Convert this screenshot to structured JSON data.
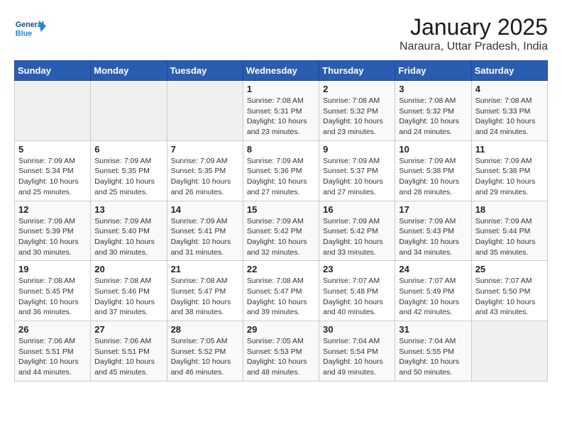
{
  "header": {
    "logo_text_general": "General",
    "logo_text_blue": "Blue",
    "main_title": "January 2025",
    "subtitle": "Naraura, Uttar Pradesh, India"
  },
  "days_of_week": [
    "Sunday",
    "Monday",
    "Tuesday",
    "Wednesday",
    "Thursday",
    "Friday",
    "Saturday"
  ],
  "weeks": [
    [
      {
        "day": "",
        "info": ""
      },
      {
        "day": "",
        "info": ""
      },
      {
        "day": "",
        "info": ""
      },
      {
        "day": "1",
        "info": "Sunrise: 7:08 AM\nSunset: 5:31 PM\nDaylight: 10 hours and 23 minutes."
      },
      {
        "day": "2",
        "info": "Sunrise: 7:08 AM\nSunset: 5:32 PM\nDaylight: 10 hours and 23 minutes."
      },
      {
        "day": "3",
        "info": "Sunrise: 7:08 AM\nSunset: 5:32 PM\nDaylight: 10 hours and 24 minutes."
      },
      {
        "day": "4",
        "info": "Sunrise: 7:08 AM\nSunset: 5:33 PM\nDaylight: 10 hours and 24 minutes."
      }
    ],
    [
      {
        "day": "5",
        "info": "Sunrise: 7:09 AM\nSunset: 5:34 PM\nDaylight: 10 hours and 25 minutes."
      },
      {
        "day": "6",
        "info": "Sunrise: 7:09 AM\nSunset: 5:35 PM\nDaylight: 10 hours and 25 minutes."
      },
      {
        "day": "7",
        "info": "Sunrise: 7:09 AM\nSunset: 5:35 PM\nDaylight: 10 hours and 26 minutes."
      },
      {
        "day": "8",
        "info": "Sunrise: 7:09 AM\nSunset: 5:36 PM\nDaylight: 10 hours and 27 minutes."
      },
      {
        "day": "9",
        "info": "Sunrise: 7:09 AM\nSunset: 5:37 PM\nDaylight: 10 hours and 27 minutes."
      },
      {
        "day": "10",
        "info": "Sunrise: 7:09 AM\nSunset: 5:38 PM\nDaylight: 10 hours and 28 minutes."
      },
      {
        "day": "11",
        "info": "Sunrise: 7:09 AM\nSunset: 5:38 PM\nDaylight: 10 hours and 29 minutes."
      }
    ],
    [
      {
        "day": "12",
        "info": "Sunrise: 7:09 AM\nSunset: 5:39 PM\nDaylight: 10 hours and 30 minutes."
      },
      {
        "day": "13",
        "info": "Sunrise: 7:09 AM\nSunset: 5:40 PM\nDaylight: 10 hours and 30 minutes."
      },
      {
        "day": "14",
        "info": "Sunrise: 7:09 AM\nSunset: 5:41 PM\nDaylight: 10 hours and 31 minutes."
      },
      {
        "day": "15",
        "info": "Sunrise: 7:09 AM\nSunset: 5:42 PM\nDaylight: 10 hours and 32 minutes."
      },
      {
        "day": "16",
        "info": "Sunrise: 7:09 AM\nSunset: 5:42 PM\nDaylight: 10 hours and 33 minutes."
      },
      {
        "day": "17",
        "info": "Sunrise: 7:09 AM\nSunset: 5:43 PM\nDaylight: 10 hours and 34 minutes."
      },
      {
        "day": "18",
        "info": "Sunrise: 7:09 AM\nSunset: 5:44 PM\nDaylight: 10 hours and 35 minutes."
      }
    ],
    [
      {
        "day": "19",
        "info": "Sunrise: 7:08 AM\nSunset: 5:45 PM\nDaylight: 10 hours and 36 minutes."
      },
      {
        "day": "20",
        "info": "Sunrise: 7:08 AM\nSunset: 5:46 PM\nDaylight: 10 hours and 37 minutes."
      },
      {
        "day": "21",
        "info": "Sunrise: 7:08 AM\nSunset: 5:47 PM\nDaylight: 10 hours and 38 minutes."
      },
      {
        "day": "22",
        "info": "Sunrise: 7:08 AM\nSunset: 5:47 PM\nDaylight: 10 hours and 39 minutes."
      },
      {
        "day": "23",
        "info": "Sunrise: 7:07 AM\nSunset: 5:48 PM\nDaylight: 10 hours and 40 minutes."
      },
      {
        "day": "24",
        "info": "Sunrise: 7:07 AM\nSunset: 5:49 PM\nDaylight: 10 hours and 42 minutes."
      },
      {
        "day": "25",
        "info": "Sunrise: 7:07 AM\nSunset: 5:50 PM\nDaylight: 10 hours and 43 minutes."
      }
    ],
    [
      {
        "day": "26",
        "info": "Sunrise: 7:06 AM\nSunset: 5:51 PM\nDaylight: 10 hours and 44 minutes."
      },
      {
        "day": "27",
        "info": "Sunrise: 7:06 AM\nSunset: 5:51 PM\nDaylight: 10 hours and 45 minutes."
      },
      {
        "day": "28",
        "info": "Sunrise: 7:05 AM\nSunset: 5:52 PM\nDaylight: 10 hours and 46 minutes."
      },
      {
        "day": "29",
        "info": "Sunrise: 7:05 AM\nSunset: 5:53 PM\nDaylight: 10 hours and 48 minutes."
      },
      {
        "day": "30",
        "info": "Sunrise: 7:04 AM\nSunset: 5:54 PM\nDaylight: 10 hours and 49 minutes."
      },
      {
        "day": "31",
        "info": "Sunrise: 7:04 AM\nSunset: 5:55 PM\nDaylight: 10 hours and 50 minutes."
      },
      {
        "day": "",
        "info": ""
      }
    ]
  ]
}
